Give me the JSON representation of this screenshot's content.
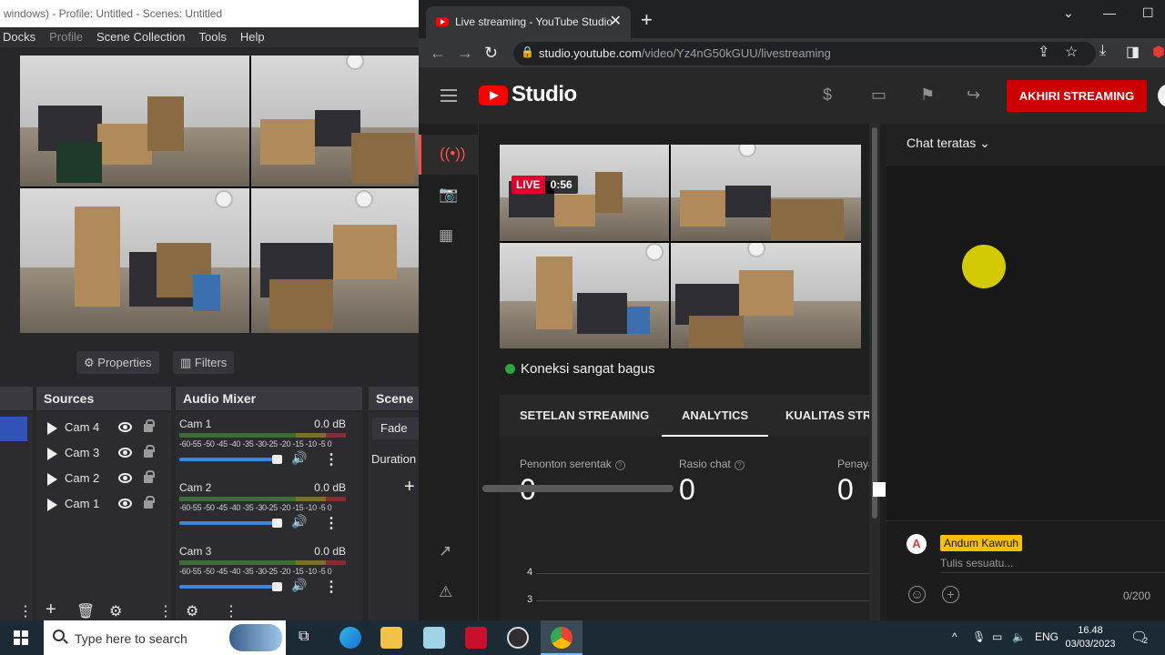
{
  "obs": {
    "title": "windows) - Profile: Untitled - Scenes: Untitled",
    "menu": [
      "Docks",
      "Profile",
      "Scene Collection",
      "Tools",
      "Help"
    ],
    "properties_label": "Properties",
    "filters_label": "Filters",
    "sources_title": "Sources",
    "audio_mixer_title": "Audio Mixer",
    "scene_transitions_title": "Scene T",
    "sources": [
      "Cam 4",
      "Cam 3",
      "Cam 2",
      "Cam 1"
    ],
    "mixer": [
      {
        "name": "Cam 1",
        "db": "0.0 dB"
      },
      {
        "name": "Cam 2",
        "db": "0.0 dB"
      },
      {
        "name": "Cam 3",
        "db": "0.0 dB"
      }
    ],
    "meter_scale": "-60-55 -50 -45 -40 -35 -30-25 -20 -15 -10 -5  0",
    "transition": "Fade",
    "duration_label": "Duration"
  },
  "browser": {
    "tab_title": "Live streaming - YouTube Studio",
    "url_domain": "studio.youtube.com",
    "url_path": "/video/Yz4nG50kGUU/livestreaming"
  },
  "studio": {
    "logo_text": "Studio",
    "end_stream_label": "AKHIRI STREAMING",
    "live_label": "LIVE",
    "live_time": "0:56",
    "connection_text": "Koneksi sangat bagus",
    "tabs": [
      "SETELAN STREAMING",
      "ANALYTICS",
      "KUALITAS STRE"
    ],
    "active_tab": "ANALYTICS",
    "stats": [
      {
        "label": "Penonton serentak",
        "value": "0"
      },
      {
        "label": "Rasio chat",
        "value": "0"
      },
      {
        "label": "Penayan",
        "value": "0"
      }
    ],
    "graph_ticks": [
      "4",
      "3"
    ]
  },
  "chat": {
    "header": "Chat teratas",
    "user_name": "Andum Kawruh",
    "input_placeholder": "Tulis sesuatu...",
    "char_count": "0/200",
    "avatar_letter": "A"
  },
  "taskbar": {
    "search_placeholder": "Type here to search",
    "lang": "ENG",
    "time": "16.48",
    "date": "03/03/2023",
    "notif_count": "2"
  }
}
